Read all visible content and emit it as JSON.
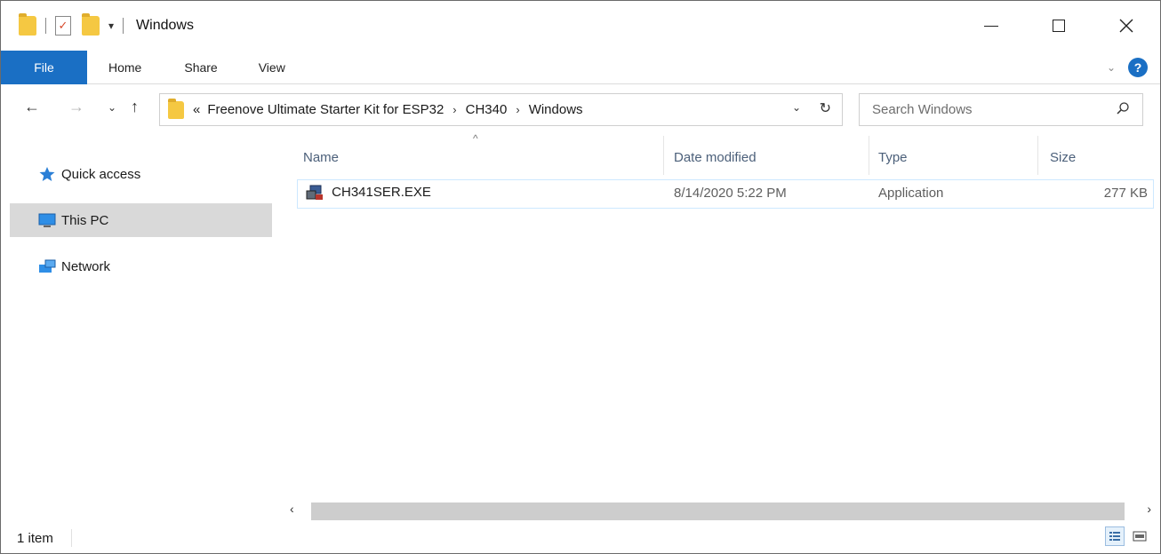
{
  "window": {
    "title": "Windows",
    "controls": [
      "minimize-icon",
      "maximize-icon",
      "close-icon"
    ]
  },
  "ribbon": {
    "file_label": "File",
    "tabs": [
      "Home",
      "Share",
      "View"
    ]
  },
  "address": {
    "overflow": "«",
    "crumbs": [
      "Freenove Ultimate Starter Kit for ESP32",
      "CH340",
      "Windows"
    ],
    "separator": "›"
  },
  "search": {
    "placeholder": "Search Windows"
  },
  "navpane": {
    "items": [
      {
        "label": "Quick access",
        "icon": "star-icon"
      },
      {
        "label": "This PC",
        "icon": "monitor-icon",
        "selected": true
      },
      {
        "label": "Network",
        "icon": "network-icon"
      }
    ]
  },
  "columns": [
    "Name",
    "Date modified",
    "Type",
    "Size"
  ],
  "files": [
    {
      "name": "CH341SER.EXE",
      "date": "8/14/2020 5:22 PM",
      "type": "Application",
      "size": "277 KB",
      "icon": "exe-icon"
    }
  ],
  "status": {
    "count": "1 item"
  },
  "colors": {
    "accent": "#1a6fc4",
    "selection_border": "#cde8ff",
    "nav_selected": "#d9d9d9",
    "header_text": "#4c607a"
  }
}
